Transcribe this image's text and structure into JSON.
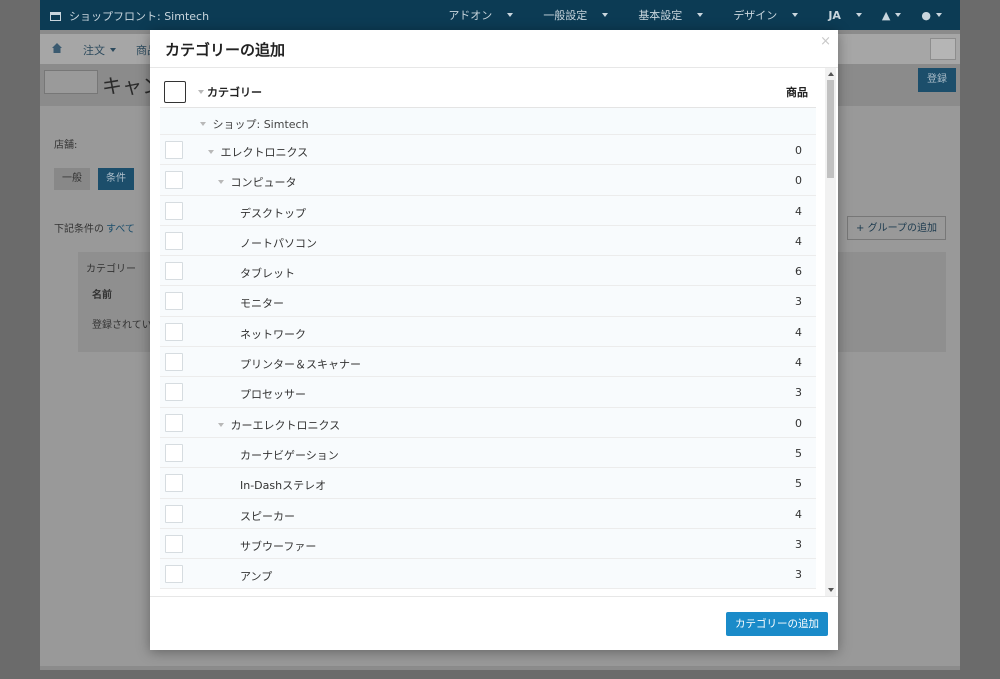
{
  "topbar": {
    "store": "ショップフロント: Simtech",
    "menu": [
      "アドオン",
      "一般設定",
      "基本設定",
      "デザイン",
      "JA"
    ]
  },
  "navbar": {
    "orders": "注文",
    "products": "商品"
  },
  "page": {
    "title": "キャン",
    "save_label": "登録",
    "name_label": "店舗:",
    "tabs": [
      "一般",
      "条件"
    ],
    "conditions_text": "下記条件の",
    "conditions_link": "すべて",
    "add_group": "グループの追加",
    "category_label": "カテゴリー",
    "name_header": "名前",
    "empty_text": "登録されてい"
  },
  "modal": {
    "title": "カテゴリーの追加",
    "close": "×",
    "header_category": "カテゴリー",
    "header_products": "商品",
    "shop_label": "ショップ: Simtech",
    "rows": [
      {
        "label": "エレクトロニクス",
        "count": "0"
      },
      {
        "label": "コンピュータ",
        "count": "0"
      },
      {
        "label": "デスクトップ",
        "count": "4"
      },
      {
        "label": "ノートパソコン",
        "count": "4"
      },
      {
        "label": "タブレット",
        "count": "6"
      },
      {
        "label": "モニター",
        "count": "3"
      },
      {
        "label": "ネットワーク",
        "count": "4"
      },
      {
        "label": "プリンター＆スキャナー",
        "count": "4"
      },
      {
        "label": "プロセッサー",
        "count": "3"
      },
      {
        "label": "カーエレクトロニクス",
        "count": "0"
      },
      {
        "label": "カーナビゲーション",
        "count": "5"
      },
      {
        "label": "In-Dashステレオ",
        "count": "5"
      },
      {
        "label": "スピーカー",
        "count": "4"
      },
      {
        "label": "サブウーファー",
        "count": "3"
      },
      {
        "label": "アンプ",
        "count": "3"
      }
    ],
    "submit_label": "カテゴリーの追加"
  }
}
